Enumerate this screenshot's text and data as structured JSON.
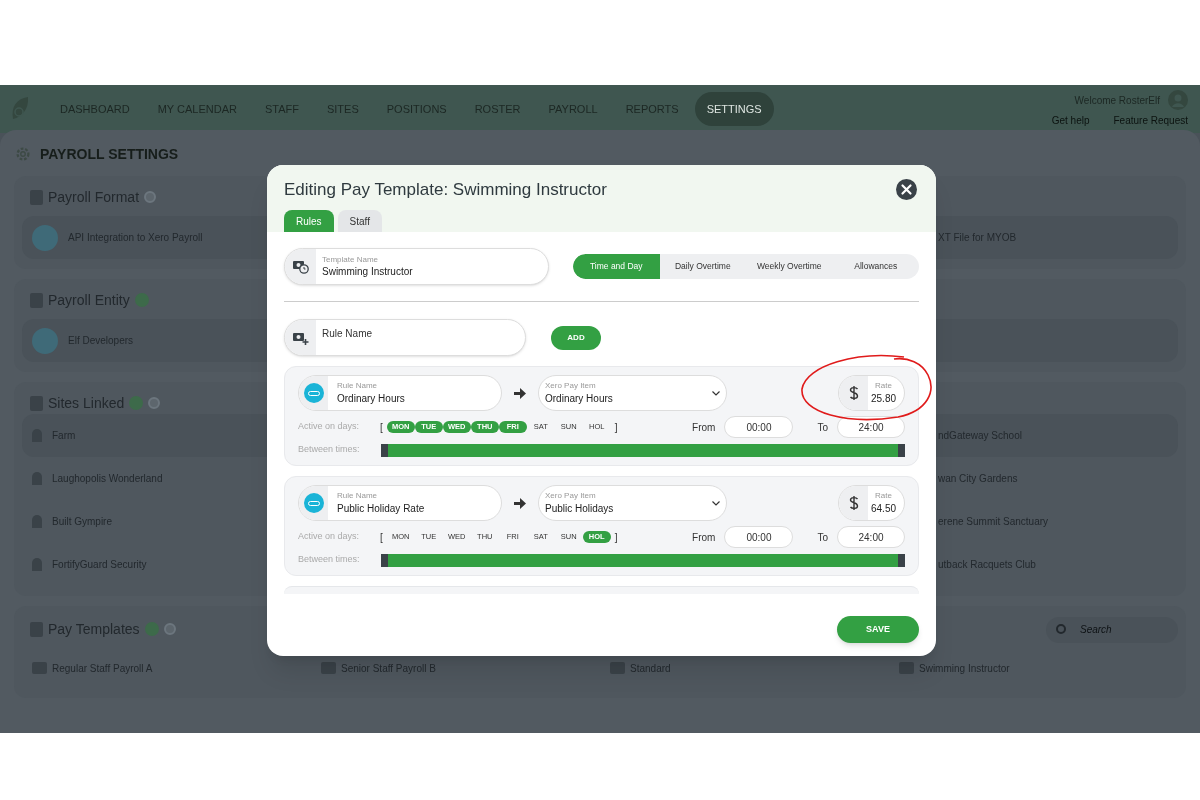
{
  "nav": {
    "items": [
      {
        "label": "DASHBOARD",
        "selected": false
      },
      {
        "label": "MY CALENDAR",
        "selected": false
      },
      {
        "label": "STAFF",
        "selected": false
      },
      {
        "label": "SITES",
        "selected": false
      },
      {
        "label": "POSITIONS",
        "selected": false
      },
      {
        "label": "ROSTER",
        "selected": false
      },
      {
        "label": "PAYROLL",
        "selected": false
      },
      {
        "label": "REPORTS",
        "selected": false
      },
      {
        "label": "SETTINGS",
        "selected": true
      }
    ],
    "welcome": "Welcome RosterElf",
    "help": "Get help",
    "feature": "Feature Request"
  },
  "page_title": "PAYROLL SETTINGS",
  "payroll_format": {
    "title": "Payroll Format",
    "left": "API Integration to Xero Payroll",
    "right": "XT File for MYOB"
  },
  "payroll_entity": {
    "title": "Payroll Entity",
    "left": "Elf Developers"
  },
  "sites_linked": {
    "title": "Sites Linked",
    "left": [
      "Farm",
      "Laughopolis Wonderland",
      "Built Gympire",
      "FortifyGuard Security"
    ],
    "right": [
      "ndGateway School",
      "wan City Gardens",
      "erene Summit Sanctuary",
      "utback Racquets Club"
    ]
  },
  "pay_templates": {
    "title": "Pay Templates",
    "search_placeholder": "Search",
    "items": [
      "Regular Staff Payroll A",
      "Senior Staff Payroll B",
      "Standard",
      "Swimming Instructor"
    ]
  },
  "modal": {
    "title": "Editing Pay Template: Swimming Instructor",
    "tabs": [
      {
        "label": "Rules",
        "selected": true
      },
      {
        "label": "Staff",
        "selected": false
      }
    ],
    "template_name": {
      "label": "Template Name",
      "value": "Swimming Instructor"
    },
    "segments": [
      {
        "label": "Time and Day",
        "selected": true
      },
      {
        "label": "Daily Overtime",
        "selected": false
      },
      {
        "label": "Weekly Overtime",
        "selected": false
      },
      {
        "label": "Allowances",
        "selected": false
      }
    ],
    "new_rule": {
      "placeholder": "Rule Name",
      "add": "ADD"
    },
    "rules": [
      {
        "name_label": "Rule Name",
        "name": "Ordinary Hours",
        "item_label": "Xero Pay Item",
        "item": "Ordinary Hours",
        "rate_label": "Rate",
        "rate": "25.80",
        "days_label": "Active on days:",
        "open": "[",
        "close": "]",
        "days": [
          {
            "label": "MON",
            "on": true
          },
          {
            "label": "TUE",
            "on": true
          },
          {
            "label": "WED",
            "on": true
          },
          {
            "label": "THU",
            "on": true
          },
          {
            "label": "FRI",
            "on": true
          },
          {
            "label": "SAT",
            "on": false
          },
          {
            "label": "SUN",
            "on": false
          },
          {
            "label": "HOL",
            "on": false
          }
        ],
        "from_label": "From",
        "from": "00:00",
        "to_label": "To",
        "to": "24:00",
        "between_label": "Between times:",
        "level": 1
      },
      {
        "name_label": "Rule Name",
        "name": "Public Holiday Rate",
        "item_label": "Xero Pay Item",
        "item": "Public Holidays",
        "rate_label": "Rate",
        "rate": "64.50",
        "days_label": "Active on days:",
        "open": "[",
        "close": "]",
        "days": [
          {
            "label": "MON",
            "on": false
          },
          {
            "label": "TUE",
            "on": false
          },
          {
            "label": "WED",
            "on": false
          },
          {
            "label": "THU",
            "on": false
          },
          {
            "label": "FRI",
            "on": false
          },
          {
            "label": "SAT",
            "on": false
          },
          {
            "label": "SUN",
            "on": false
          },
          {
            "label": "HOL",
            "on": true
          }
        ],
        "from_label": "From",
        "from": "00:00",
        "to_label": "To",
        "to": "24:00",
        "between_label": "Between times:",
        "level": 1
      }
    ],
    "save": "SAVE"
  }
}
